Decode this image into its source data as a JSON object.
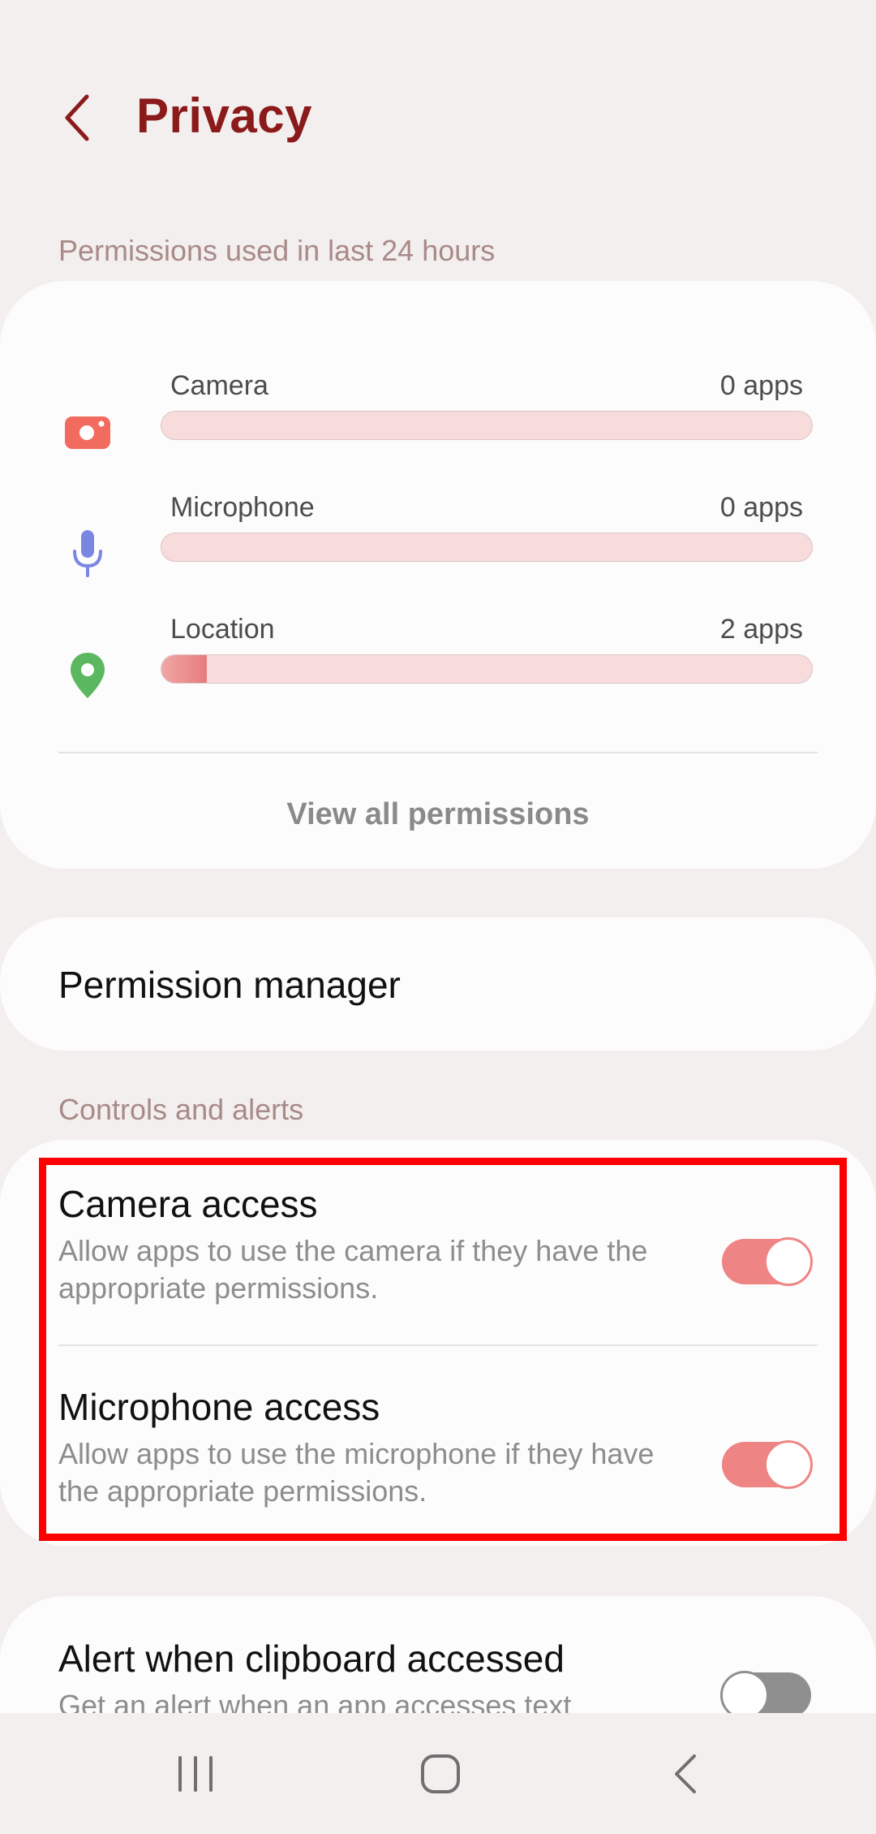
{
  "header": {
    "title": "Privacy",
    "back_icon": "chevron-left-icon"
  },
  "usage_section": {
    "title": "Permissions used in last 24 hours",
    "items": [
      {
        "label": "Camera",
        "count": "0 apps",
        "icon": "camera-icon",
        "color": "#f26b5f",
        "fill_fraction": 0.0
      },
      {
        "label": "Microphone",
        "count": "0 apps",
        "icon": "microphone-icon",
        "color": "#7b86e3",
        "fill_fraction": 0.0
      },
      {
        "label": "Location",
        "count": "2 apps",
        "icon": "location-pin-icon",
        "color": "#5cb860",
        "fill_fraction": 0.07
      }
    ],
    "view_all_label": "View all permissions"
  },
  "permission_manager": {
    "label": "Permission manager"
  },
  "controls_section": {
    "title": "Controls and alerts",
    "items": [
      {
        "title": "Camera access",
        "description": "Allow apps to use the camera if they have the appropriate permissions.",
        "enabled": true
      },
      {
        "title": "Microphone access",
        "description": "Allow apps to use the microphone if they have the appropriate permissions.",
        "enabled": true
      }
    ]
  },
  "clipboard_alert": {
    "title": "Alert when clipboard accessed",
    "description": "Get an alert when an app accesses text",
    "enabled": false
  },
  "nav_bar": {
    "recents_icon": "recents-icon",
    "home_icon": "home-icon",
    "back_icon": "back-icon"
  },
  "colors": {
    "title": "#8b1a1a",
    "section_title": "#a88a88",
    "toggle_on": "#ef8484",
    "toggle_off": "#8f8f8f",
    "highlight": "#ff0000"
  }
}
